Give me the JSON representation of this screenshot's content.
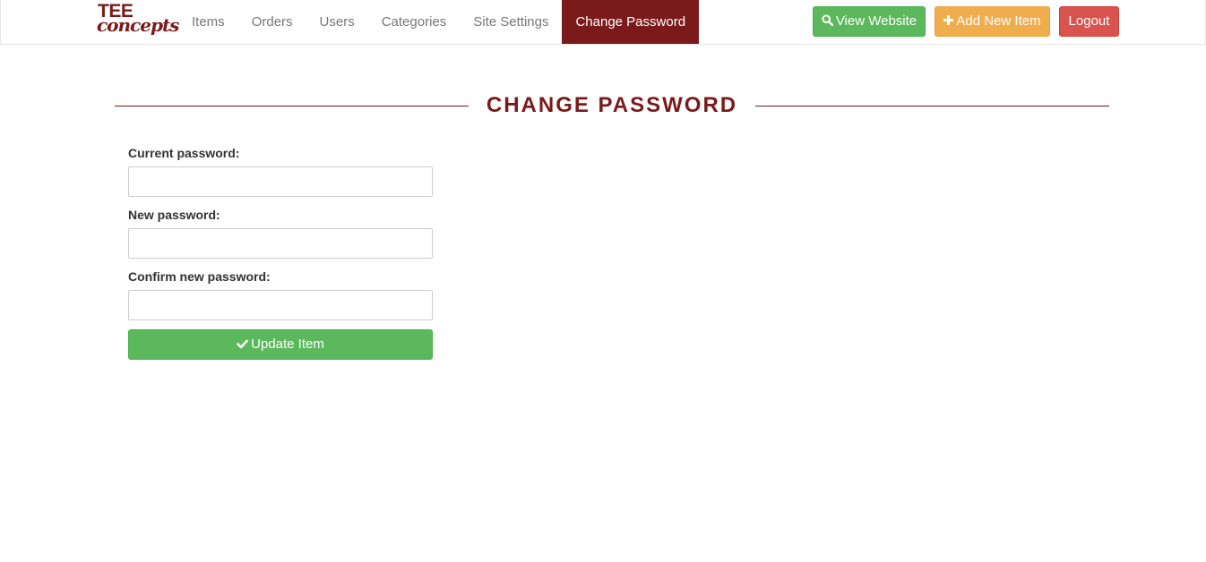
{
  "brand": {
    "line1": "TEE",
    "line2": "concepts",
    "color": "#7a1a1a"
  },
  "nav": {
    "items": [
      {
        "label": "Items"
      },
      {
        "label": "Orders"
      },
      {
        "label": "Users"
      },
      {
        "label": "Categories"
      },
      {
        "label": "Site Settings"
      },
      {
        "label": "Change Password",
        "active": true
      }
    ],
    "buttons": {
      "view_website": {
        "label": "View Website",
        "icon": "search-icon",
        "color": "#5cb85c"
      },
      "add_new_item": {
        "label": "Add New Item",
        "icon": "plus-icon",
        "color": "#f0ad4e"
      },
      "logout": {
        "label": "Logout",
        "color": "#d9534f"
      }
    }
  },
  "page": {
    "title": "CHANGE PASSWORD"
  },
  "form": {
    "current_password": {
      "label": "Current password:",
      "value": ""
    },
    "new_password": {
      "label": "New password:",
      "value": ""
    },
    "confirm_password": {
      "label": "Confirm new password:",
      "value": ""
    },
    "submit": {
      "label": "Update Item",
      "icon": "check-icon",
      "color": "#5cb85c"
    }
  }
}
